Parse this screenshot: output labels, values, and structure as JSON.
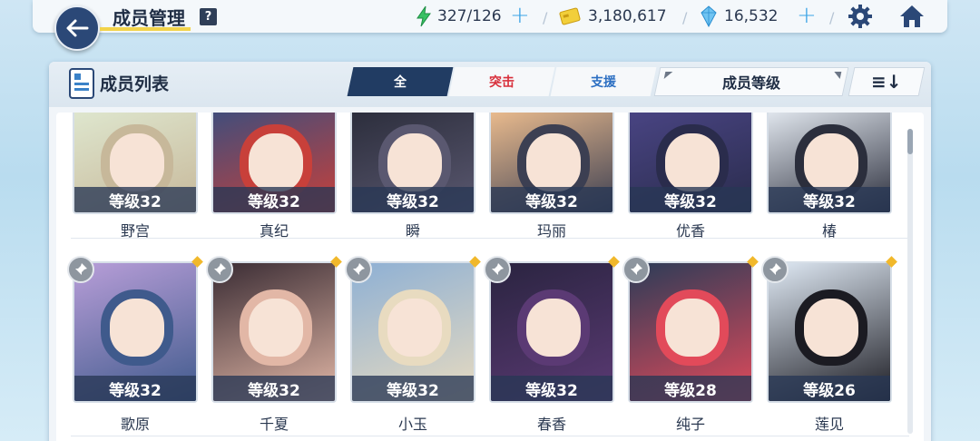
{
  "header": {
    "title": "成员管理",
    "help": "?",
    "stamina": "327/126",
    "credits": "3,180,617",
    "gems": "16,532",
    "separator": "/"
  },
  "panel": {
    "title": "成员列表",
    "tabs": [
      {
        "label": "全"
      },
      {
        "label": "突击"
      },
      {
        "label": "支援"
      }
    ],
    "sort_label": "成员等级",
    "sort_dir": "≡↓"
  },
  "members_row1": [
    {
      "name": "野宫",
      "level": "等级32",
      "color1": "#dfe8d0",
      "color2": "#c7b89a"
    },
    {
      "name": "真纪",
      "level": "等级32",
      "color1": "#3b4e7e",
      "color2": "#c8403a"
    },
    {
      "name": "瞬",
      "level": "等级32",
      "color1": "#2a2c3a",
      "color2": "#5a5870"
    },
    {
      "name": "玛丽",
      "level": "等级32",
      "color1": "#f1c090",
      "color2": "#3c3f52"
    },
    {
      "name": "优香",
      "level": "等级32",
      "color1": "#4a4585",
      "color2": "#2a2c4c"
    },
    {
      "name": "椿",
      "level": "等级32",
      "color1": "#e8eef5",
      "color2": "#2b2e3c"
    }
  ],
  "members_row2": [
    {
      "name": "歌原",
      "level": "等级32",
      "color1": "#b89ed8",
      "color2": "#3f5a8c"
    },
    {
      "name": "千夏",
      "level": "等级32",
      "color1": "#3a2c34",
      "color2": "#e2b7a6"
    },
    {
      "name": "小玉",
      "level": "等级32",
      "color1": "#8eb0d4",
      "color2": "#e8dbc0"
    },
    {
      "name": "春香",
      "level": "等级32",
      "color1": "#2a2440",
      "color2": "#5b3a74"
    },
    {
      "name": "纯子",
      "level": "等级28",
      "color1": "#2c3c58",
      "color2": "#e24a5a"
    },
    {
      "name": "莲见",
      "level": "等级26",
      "color1": "#dfe9f4",
      "color2": "#1b1b22"
    }
  ],
  "colors": {
    "accent_navy": "#213c63",
    "assault_red": "#d8303b",
    "support_blue": "#2c6fc2",
    "level_badge": "#283755",
    "new_marker": "#f1b82b"
  }
}
